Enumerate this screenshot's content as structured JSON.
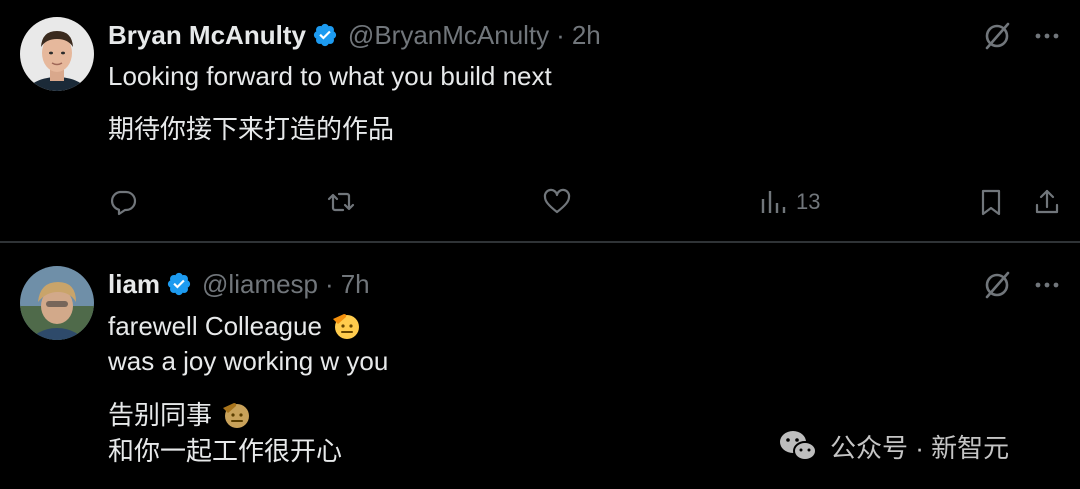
{
  "tweets": [
    {
      "display_name": "Bryan McAnulty",
      "handle": "@BryanMcAnulty",
      "separator": "·",
      "time": "2h",
      "text_en": "Looking forward to what you build next",
      "text_zh": "期待你接下来打造的作品",
      "views": "13"
    },
    {
      "display_name": "liam",
      "handle": "@liamesp",
      "separator": "·",
      "time": "7h",
      "line1": "farewell Colleague",
      "line2": "was a joy working w you",
      "line3": "告别同事",
      "line4": "和你一起工作很开心"
    }
  ],
  "icons": {
    "verified": "verified-badge-icon",
    "grok": "grok-icon",
    "more": "more-icon",
    "reply": "reply-icon",
    "retweet": "retweet-icon",
    "like": "heart-icon",
    "views": "views-icon",
    "bookmark": "bookmark-icon",
    "share": "share-icon",
    "emoji": "saluting-face-emoji",
    "wechat": "wechat-icon"
  },
  "watermark": {
    "text": "公众号 · 新智元"
  },
  "colors": {
    "background": "#000000",
    "primary_text": "#e7e9ea",
    "secondary_text": "#71767b",
    "verified_blue": "#1d9bf0",
    "divider": "#2f3336"
  }
}
